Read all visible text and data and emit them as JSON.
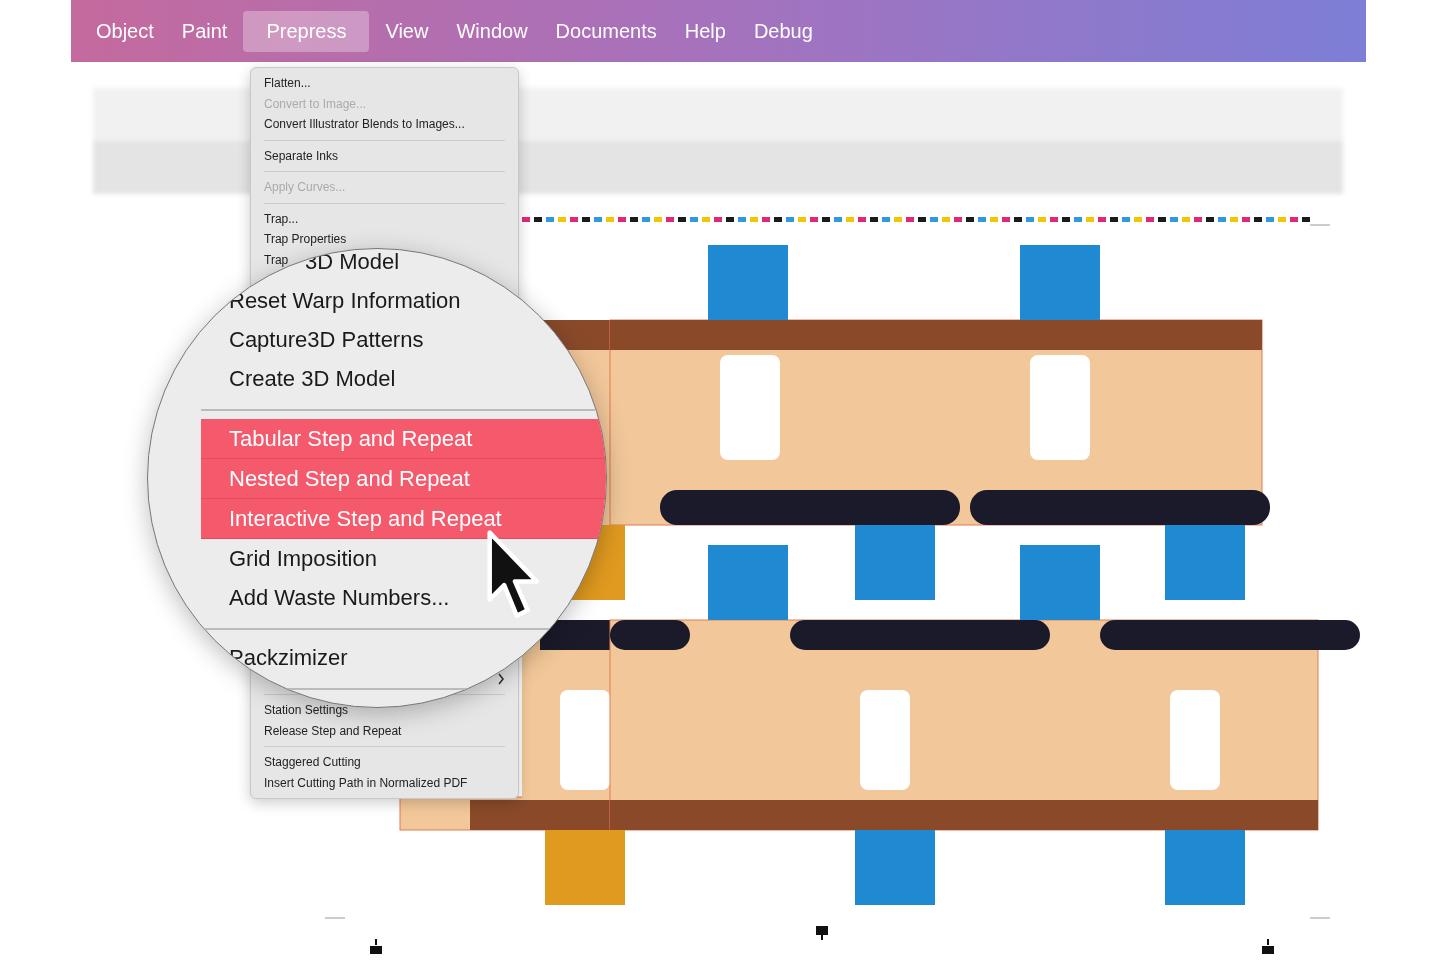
{
  "menu_bar": {
    "items": [
      {
        "label": "Object",
        "selected": false
      },
      {
        "label": "Paint",
        "selected": false
      },
      {
        "label": "Prepress",
        "selected": true
      },
      {
        "label": "View",
        "selected": false
      },
      {
        "label": "Window",
        "selected": false
      },
      {
        "label": "Documents",
        "selected": false
      },
      {
        "label": "Help",
        "selected": false
      },
      {
        "label": "Debug",
        "selected": false
      }
    ]
  },
  "prepress_menu": {
    "top_items": [
      {
        "kind": "item",
        "label": "Flatten...",
        "disabled": false
      },
      {
        "kind": "item",
        "label": "Convert to Image...",
        "disabled": true
      },
      {
        "kind": "item",
        "label": "Convert Illustrator Blends to Images...",
        "disabled": false
      },
      {
        "kind": "separator"
      },
      {
        "kind": "item",
        "label": "Separate Inks",
        "disabled": false
      },
      {
        "kind": "separator"
      },
      {
        "kind": "item",
        "label": "Apply Curves...",
        "disabled": true
      },
      {
        "kind": "separator"
      },
      {
        "kind": "item",
        "label": "Trap...",
        "disabled": false
      },
      {
        "kind": "item",
        "label": "Trap Properties",
        "disabled": false
      },
      {
        "kind": "item",
        "label": "Trap",
        "disabled": false
      }
    ],
    "bottom_items": [
      {
        "kind": "submenu"
      },
      {
        "kind": "separator"
      },
      {
        "kind": "item",
        "label": "Station Settings",
        "disabled": false
      },
      {
        "kind": "item",
        "label": "Release Step and Repeat",
        "disabled": false
      },
      {
        "kind": "separator"
      },
      {
        "kind": "item",
        "label": "Staggered Cutting",
        "disabled": false
      },
      {
        "kind": "item",
        "label": "Insert Cutting Path in Normalized PDF",
        "disabled": false
      }
    ]
  },
  "magnifier": {
    "items": [
      {
        "kind": "item",
        "label": "3D Model",
        "highlighted": false
      },
      {
        "kind": "item",
        "label": "Reset Warp Information",
        "highlighted": false
      },
      {
        "kind": "item",
        "label": "Capture3D Patterns",
        "highlighted": false
      },
      {
        "kind": "item",
        "label": "Create 3D Model",
        "highlighted": false
      },
      {
        "kind": "separator"
      },
      {
        "kind": "item",
        "label": "Tabular Step and Repeat",
        "highlighted": true
      },
      {
        "kind": "item",
        "label": "Nested Step and Repeat",
        "highlighted": true
      },
      {
        "kind": "item",
        "label": "Interactive Step and Repeat",
        "highlighted": true
      },
      {
        "kind": "item",
        "label": "Grid Imposition",
        "highlighted": false
      },
      {
        "kind": "item",
        "label": "Add Waste Numbers...",
        "highlighted": false
      },
      {
        "kind": "separator"
      },
      {
        "kind": "item",
        "label": "Packzimizer",
        "highlighted": false
      },
      {
        "kind": "separator"
      }
    ]
  }
}
